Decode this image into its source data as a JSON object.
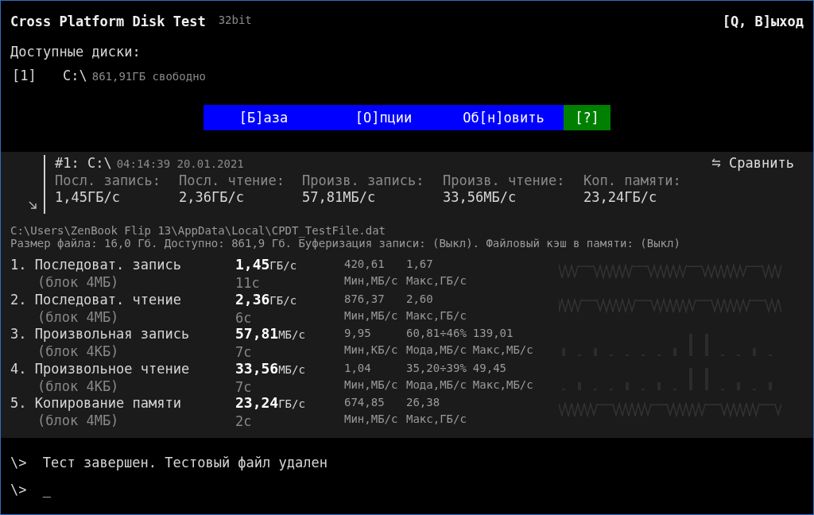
{
  "app": {
    "title": "Cross Platform Disk Test",
    "build": "32bit",
    "exit_hint": "[Q, B]ыход"
  },
  "drives": {
    "heading": "Доступные диски:",
    "items": [
      {
        "key": "[1]",
        "path": "C:\\",
        "free": "861,91ГБ свободно"
      }
    ]
  },
  "menu": [
    {
      "label": "[Б]аза",
      "kind": "main"
    },
    {
      "label": "[О]пции",
      "kind": "main"
    },
    {
      "label": "Об[н]овить",
      "kind": "main"
    },
    {
      "label": "[?]",
      "kind": "help"
    }
  ],
  "summary": {
    "title": "#1: C:\\",
    "timestamp": "04:14:39 20.01.2021",
    "compare": "Сравнить",
    "columns": [
      {
        "label": "Посл. запись:",
        "value": "1,45ГБ/с"
      },
      {
        "label": "Посл. чтение:",
        "value": "2,36ГБ/с"
      },
      {
        "label": "Произв. запись:",
        "value": "57,81МБ/с"
      },
      {
        "label": "Произв. чтение:",
        "value": "33,56МБ/с"
      },
      {
        "label": "Коп. памяти:",
        "value": "23,24ГБ/с"
      }
    ]
  },
  "test_file": {
    "path": "C:\\Users\\ZenBook Flip 13\\AppData\\Local\\CPDT_TestFile.dat",
    "info": "Размер файла: 16,0 Гб. Доступно: 861,9 Гб. Буферизация записи: (Выкл). Файловый кэш в памяти: (Выкл)"
  },
  "results": [
    {
      "name": "1. Последоват. запись",
      "block": "(блок 4МБ)",
      "speed": "1,45",
      "unit": "ГБ/с",
      "duration": "11с",
      "kind": "wave",
      "stats": [
        {
          "value": "420,61",
          "label": "Мин,МБ/с"
        },
        {
          "value": "1,67",
          "label": "Макс,ГБ/с"
        }
      ]
    },
    {
      "name": "2. Последоват. чтение",
      "block": "(блок 4МБ)",
      "speed": "2,36",
      "unit": "ГБ/с",
      "duration": "6с",
      "kind": "wave",
      "stats": [
        {
          "value": "876,37",
          "label": "Мин,МБ/с"
        },
        {
          "value": "2,60",
          "label": "Макс,ГБ/с"
        }
      ]
    },
    {
      "name": "3. Произвольная запись",
      "block": "(блок 4КБ)",
      "speed": "57,81",
      "unit": "МБ/с",
      "duration": "7с",
      "kind": "histogram",
      "stats": [
        {
          "value": "9,95",
          "label": "Мин,КБ/с"
        },
        {
          "value": "60,81÷46%",
          "label": "Мода,МБ/с"
        },
        {
          "value": "139,01",
          "label": "Макс,МБ/с"
        }
      ]
    },
    {
      "name": "4. Произвольное чтение",
      "block": "(блок 4КБ)",
      "speed": "33,56",
      "unit": "МБ/с",
      "duration": "7с",
      "kind": "histogram",
      "stats": [
        {
          "value": "1,04",
          "label": "Мин,МБ/с"
        },
        {
          "value": "35,20÷39%",
          "label": "Мода,МБ/с"
        },
        {
          "value": "49,45",
          "label": "Макс,МБ/с"
        }
      ]
    },
    {
      "name": "5. Копирование памяти",
      "block": "(блок 4МБ)",
      "speed": "23,24",
      "unit": "ГБ/с",
      "duration": "2с",
      "kind": "wave",
      "stats": [
        {
          "value": "674,85",
          "label": "Мин,МБ/с"
        },
        {
          "value": "26,38",
          "label": "Макс,ГБ/с"
        }
      ]
    }
  ],
  "console": [
    {
      "prompt": "\\>",
      "text": "Тест завершен. Тестовый файл удален"
    },
    {
      "prompt": "\\>",
      "text": "_"
    }
  ]
}
